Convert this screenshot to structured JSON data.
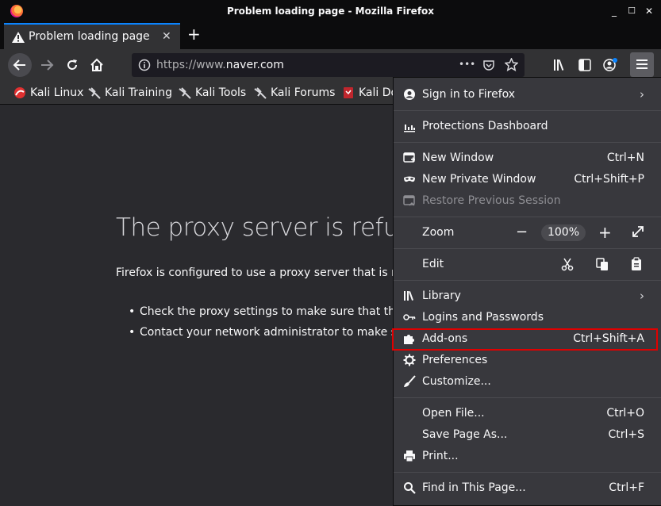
{
  "window": {
    "title": "Problem loading page - Mozilla Firefox",
    "minimize": "_",
    "maximize": "☐",
    "close": "✕"
  },
  "tab": {
    "title": "Problem loading page",
    "close": "✕",
    "new_tab": "+"
  },
  "urlbar": {
    "prefix": "https://www.",
    "host": "naver.com",
    "more": "•••"
  },
  "bookmarks": [
    {
      "label": "Kali Linux"
    },
    {
      "label": "Kali Training"
    },
    {
      "label": "Kali Tools"
    },
    {
      "label": "Kali Forums"
    },
    {
      "label": "Kali Do"
    }
  ],
  "error_page": {
    "title": "The proxy server is refusin",
    "description": "Firefox is configured to use a proxy server that is refu",
    "bullets": [
      "Check the proxy settings to make sure that they a",
      "Contact your network administrator to make sur"
    ]
  },
  "menu": {
    "sign_in": "Sign in to Firefox",
    "protections": "Protections Dashboard",
    "new_window": {
      "label": "New Window",
      "shortcut": "Ctrl+N"
    },
    "new_private": {
      "label": "New Private Window",
      "shortcut": "Ctrl+Shift+P"
    },
    "restore": "Restore Previous Session",
    "zoom": {
      "label": "Zoom",
      "minus": "−",
      "value": "100%",
      "plus": "+"
    },
    "edit": "Edit",
    "library": "Library",
    "logins": "Logins and Passwords",
    "addons": {
      "label": "Add-ons",
      "shortcut": "Ctrl+Shift+A"
    },
    "preferences": "Preferences",
    "customize": "Customize...",
    "open_file": {
      "label": "Open File...",
      "shortcut": "Ctrl+O"
    },
    "save_page": {
      "label": "Save Page As...",
      "shortcut": "Ctrl+S"
    },
    "print": "Print...",
    "find": {
      "label": "Find in This Page...",
      "shortcut": "Ctrl+F"
    },
    "chevron": "›"
  },
  "colors": {
    "highlight": "#e00000",
    "accent": "#0a84ff"
  }
}
